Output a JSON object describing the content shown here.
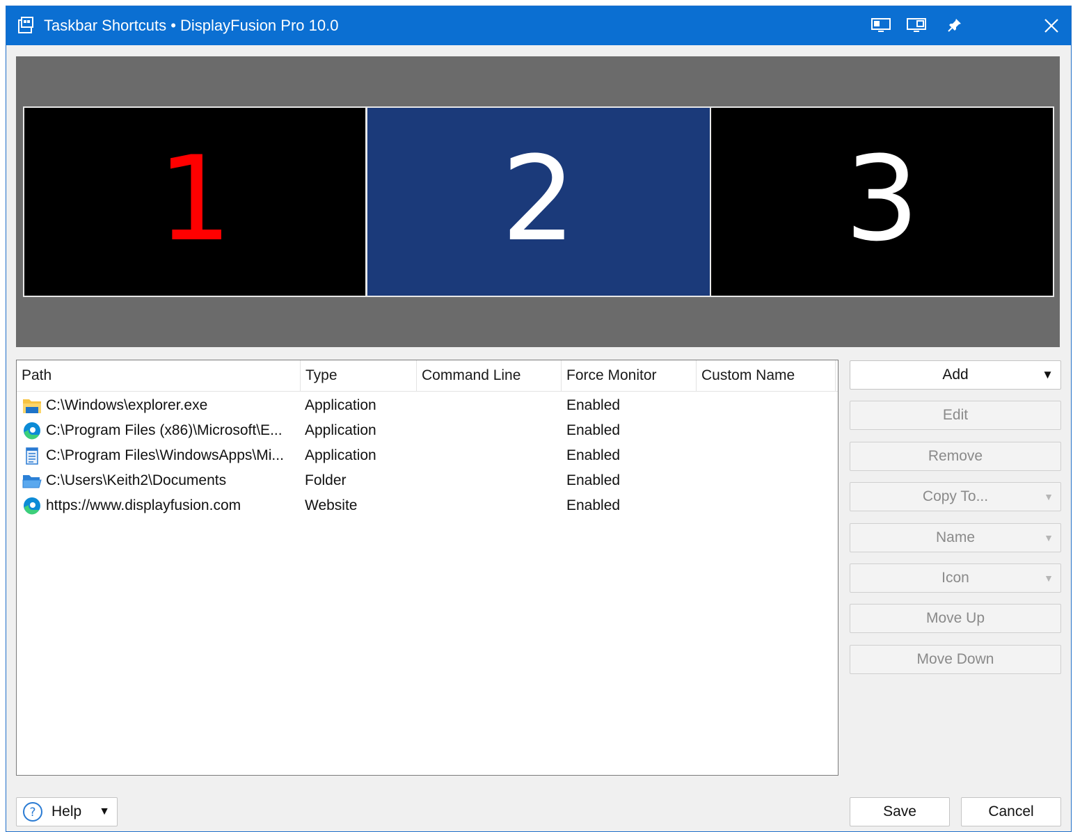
{
  "window": {
    "title": "Taskbar Shortcuts • DisplayFusion Pro 10.0",
    "titlebar_buttons": [
      "monitor-split-icon",
      "monitor-config-icon",
      "pin-icon",
      "close-icon"
    ]
  },
  "monitors": [
    {
      "label": "1",
      "selected": false,
      "color": "#ff0000",
      "background": "#000000"
    },
    {
      "label": "2",
      "selected": true,
      "color": "#ffffff",
      "background": "#1b3a7a"
    },
    {
      "label": "3",
      "selected": false,
      "color": "#ffffff",
      "background": "#000000"
    }
  ],
  "list": {
    "columns": [
      "Path",
      "Type",
      "Command Line",
      "Force Monitor",
      "Custom Name"
    ],
    "rows": [
      {
        "icon": "folder-explorer-icon",
        "path": "C:\\Windows\\explorer.exe",
        "type": "Application",
        "command_line": "",
        "force_monitor": "Enabled",
        "custom_name": ""
      },
      {
        "icon": "edge-icon",
        "path": "C:\\Program Files (x86)\\Microsoft\\E...",
        "type": "Application",
        "command_line": "",
        "force_monitor": "Enabled",
        "custom_name": ""
      },
      {
        "icon": "notepad-icon",
        "path": "C:\\Program Files\\WindowsApps\\Mi...",
        "type": "Application",
        "command_line": "",
        "force_monitor": "Enabled",
        "custom_name": ""
      },
      {
        "icon": "open-folder-icon",
        "path": "C:\\Users\\Keith2\\Documents",
        "type": "Folder",
        "command_line": "",
        "force_monitor": "Enabled",
        "custom_name": ""
      },
      {
        "icon": "edge-icon",
        "path": "https://www.displayfusion.com",
        "type": "Website",
        "command_line": "",
        "force_monitor": "Enabled",
        "custom_name": ""
      }
    ]
  },
  "actions": {
    "add": "Add",
    "edit": "Edit",
    "remove": "Remove",
    "copy_to": "Copy To...",
    "name": "Name",
    "icon": "Icon",
    "move_up": "Move Up",
    "move_down": "Move Down"
  },
  "footer": {
    "help": "Help",
    "save": "Save",
    "cancel": "Cancel"
  }
}
